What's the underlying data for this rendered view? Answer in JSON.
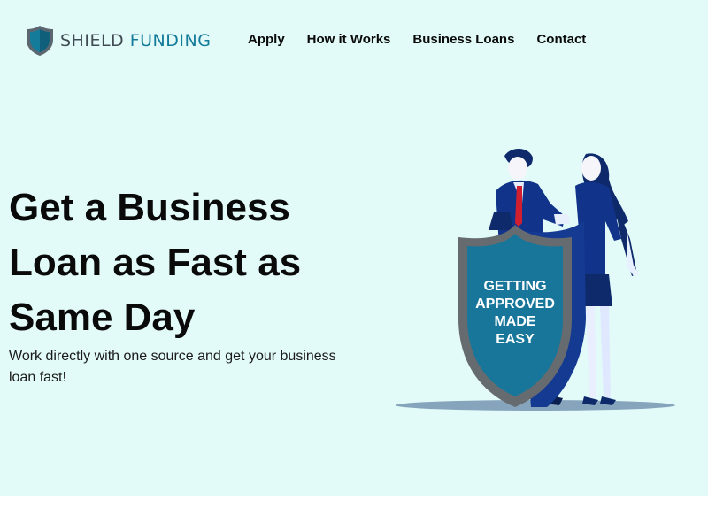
{
  "header": {
    "logo": {
      "word1": "SHIELD",
      "word2": "FUNDING",
      "icon": "shield-icon"
    },
    "nav": [
      {
        "label": "Apply"
      },
      {
        "label": "How it Works"
      },
      {
        "label": "Business Loans"
      },
      {
        "label": "Contact"
      }
    ]
  },
  "hero": {
    "headline": "Get a Business Loan as Fast as Same Day",
    "subtext": "Work directly with one source and get your business loan fast!",
    "illustration": {
      "shield_text": [
        "GETTING",
        "APPROVED",
        "MADE",
        "EASY"
      ]
    }
  },
  "colors": {
    "hero_background": "#e2fbf8",
    "brand_teal": "#147b9a",
    "brand_gray": "#3f4a52",
    "navy": "#0f2a6b"
  }
}
